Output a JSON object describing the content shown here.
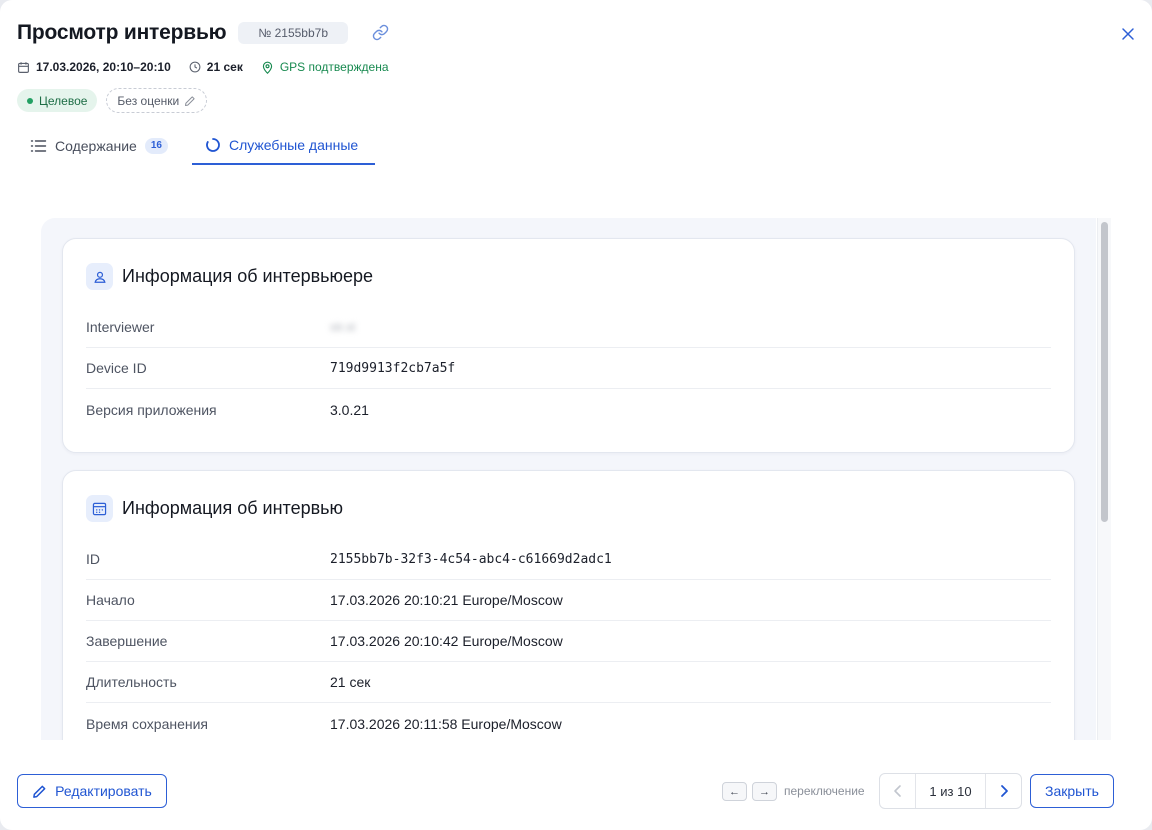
{
  "header": {
    "title": "Просмотр интервью",
    "id_badge": "№ 2155bb7b",
    "datetime": "17.03.2026, 20:10–20:10",
    "duration": "21 сек",
    "gps_status": "GPS подтверждена"
  },
  "tags": {
    "status": "Целевое",
    "score": "Без оценки"
  },
  "tabs": [
    {
      "label": "Содержание",
      "count": "16",
      "active": false
    },
    {
      "label": "Служебные данные",
      "active": true
    }
  ],
  "interviewer_card": {
    "title": "Информация об интервьюере",
    "rows": [
      {
        "key": "Interviewer",
        "value": "str.st"
      },
      {
        "key": "Device ID",
        "value": "719d9913f2cb7a5f"
      },
      {
        "key": "Версия приложения",
        "value": "3.0.21"
      }
    ]
  },
  "interview_card": {
    "title": "Информация об интервью",
    "rows": [
      {
        "key": "ID",
        "value": "2155bb7b-32f3-4c54-abc4-c61669d2adc1"
      },
      {
        "key": "Начало",
        "value": "17.03.2026 20:10:21 Europe/Moscow"
      },
      {
        "key": "Завершение",
        "value": "17.03.2026 20:10:42 Europe/Moscow"
      },
      {
        "key": "Длительность",
        "value": "21 сек"
      },
      {
        "key": "Время сохранения",
        "value": "17.03.2026 20:11:58 Europe/Moscow"
      }
    ]
  },
  "footer": {
    "edit_label": "Редактировать",
    "key_prev": "←",
    "key_next": "→",
    "switch_hint": "переключение",
    "pager_text": "1 из 10",
    "close_label": "Закрыть"
  },
  "colors": {
    "accent": "#2d5fd6",
    "success": "#17894f",
    "success_bg": "#e5f4ec"
  }
}
